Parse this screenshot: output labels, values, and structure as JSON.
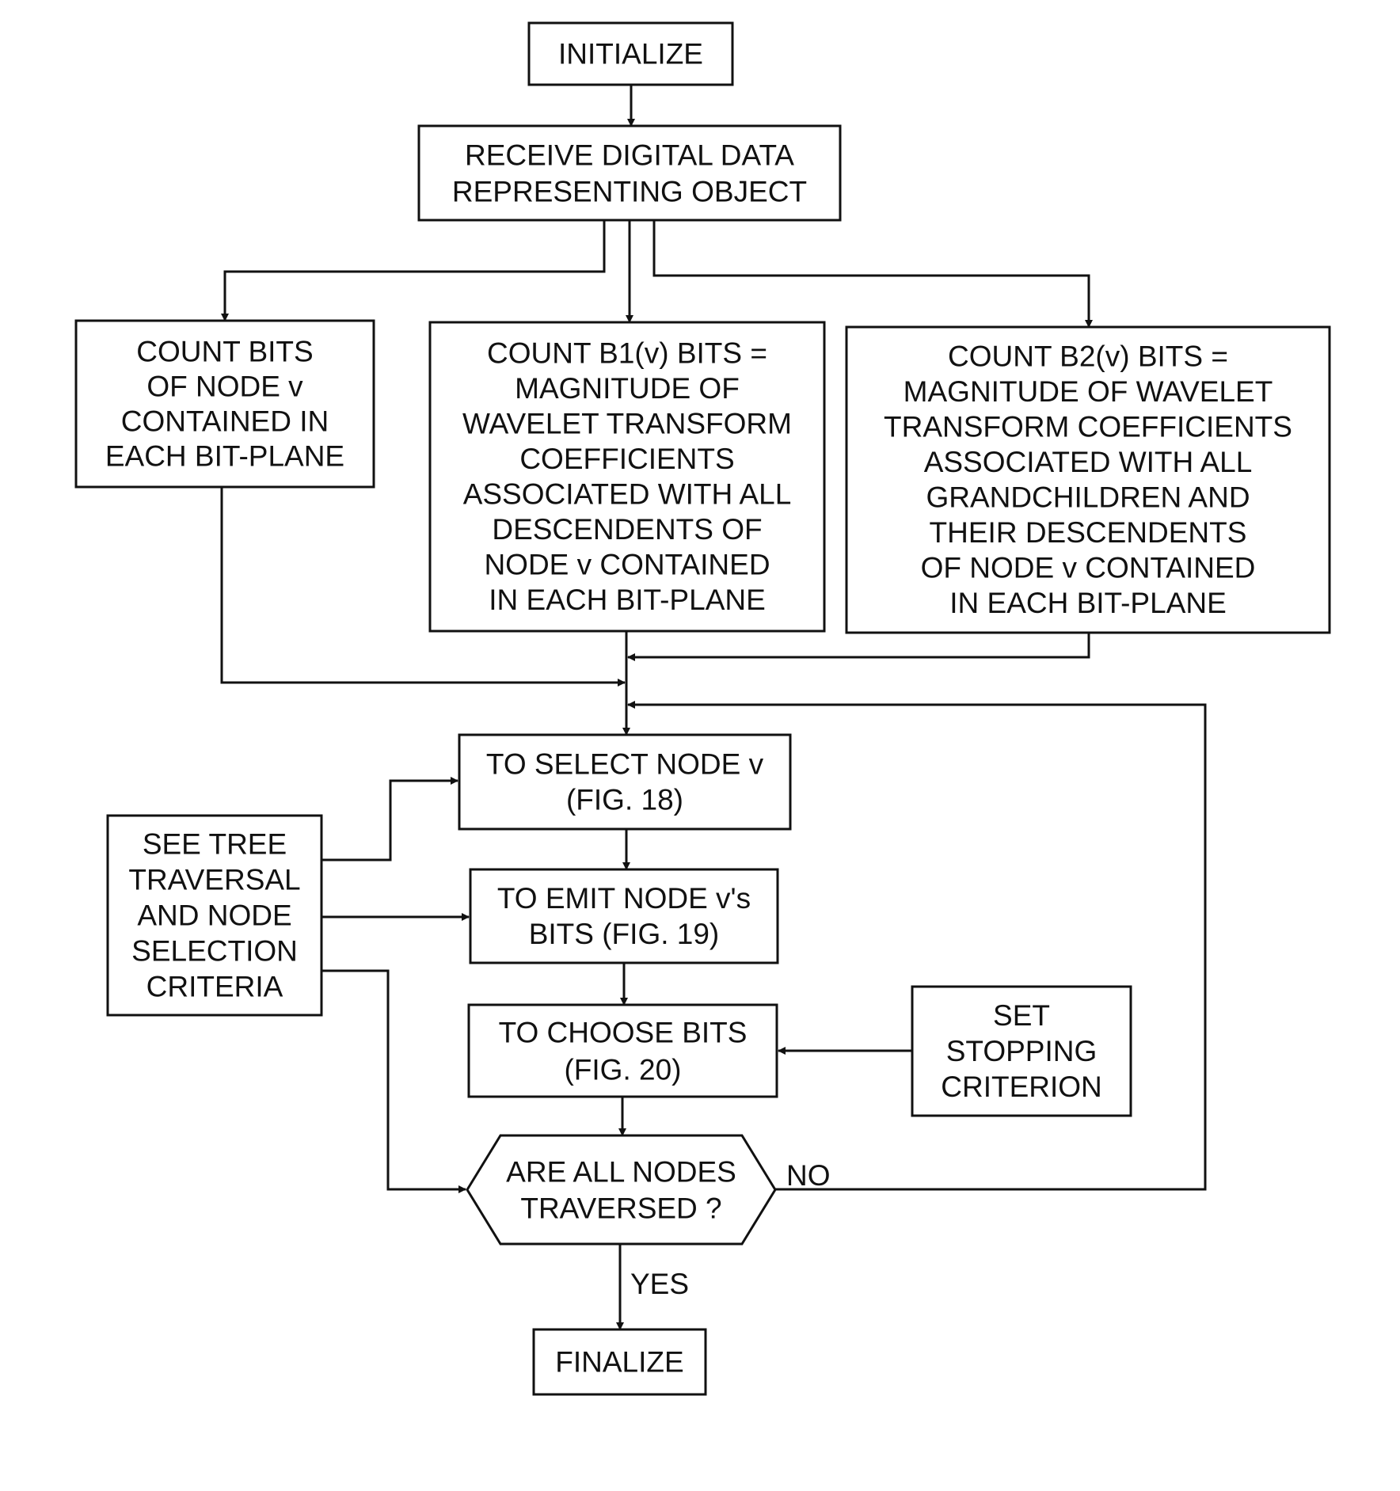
{
  "figure": {
    "type": "flowchart",
    "nodes": [
      {
        "id": "initialize",
        "shape": "rect",
        "lines": [
          "INITIALIZE"
        ]
      },
      {
        "id": "receive",
        "shape": "rect",
        "lines": [
          "RECEIVE DIGITAL DATA",
          "REPRESENTING OBJECT"
        ]
      },
      {
        "id": "count-bits",
        "shape": "rect",
        "lines": [
          "COUNT BITS",
          "OF NODE v",
          "CONTAINED IN",
          "EACH BIT-PLANE"
        ]
      },
      {
        "id": "count-b1",
        "shape": "rect",
        "lines": [
          "COUNT B1(v) BITS =",
          "MAGNITUDE OF",
          "WAVELET TRANSFORM",
          "COEFFICIENTS",
          "ASSOCIATED WITH ALL",
          "DESCENDENTS OF",
          "NODE v CONTAINED",
          "IN EACH BIT-PLANE"
        ]
      },
      {
        "id": "count-b2",
        "shape": "rect",
        "lines": [
          "COUNT B2(v) BITS =",
          "MAGNITUDE OF WAVELET",
          "TRANSFORM COEFFICIENTS",
          "ASSOCIATED WITH ALL",
          "GRANDCHILDREN AND",
          "THEIR DESCENDENTS",
          "OF NODE v CONTAINED",
          "IN EACH BIT-PLANE"
        ]
      },
      {
        "id": "select-node",
        "shape": "rect",
        "lines": [
          "TO SELECT NODE v",
          "(FIG. 18)"
        ]
      },
      {
        "id": "tree-traversal",
        "shape": "rect",
        "lines": [
          "SEE TREE",
          "TRAVERSAL",
          "AND NODE",
          "SELECTION",
          "CRITERIA"
        ]
      },
      {
        "id": "emit-bits",
        "shape": "rect",
        "lines": [
          "TO EMIT NODE v's",
          "BITS (FIG. 19)"
        ]
      },
      {
        "id": "choose-bits",
        "shape": "rect",
        "lines": [
          "TO CHOOSE BITS",
          "(FIG. 20)"
        ]
      },
      {
        "id": "stopping",
        "shape": "rect",
        "lines": [
          "SET",
          "STOPPING",
          "CRITERION"
        ]
      },
      {
        "id": "all-traversed",
        "shape": "hexagon",
        "lines": [
          "ARE ALL NODES",
          "TRAVERSED ?"
        ]
      },
      {
        "id": "finalize",
        "shape": "rect",
        "lines": [
          "FINALIZE"
        ]
      }
    ],
    "edges": [
      {
        "from": "initialize",
        "to": "receive"
      },
      {
        "from": "receive",
        "to": "count-bits"
      },
      {
        "from": "receive",
        "to": "count-b1"
      },
      {
        "from": "receive",
        "to": "count-b2"
      },
      {
        "from": "count-bits",
        "to": "select-node"
      },
      {
        "from": "count-b1",
        "to": "select-node"
      },
      {
        "from": "count-b2",
        "to": "select-node"
      },
      {
        "from": "tree-traversal",
        "to": "select-node"
      },
      {
        "from": "tree-traversal",
        "to": "emit-bits"
      },
      {
        "from": "tree-traversal",
        "to": "all-traversed"
      },
      {
        "from": "select-node",
        "to": "emit-bits"
      },
      {
        "from": "emit-bits",
        "to": "choose-bits"
      },
      {
        "from": "stopping",
        "to": "choose-bits"
      },
      {
        "from": "choose-bits",
        "to": "all-traversed"
      },
      {
        "from": "all-traversed",
        "to": "select-node",
        "label": "NO"
      },
      {
        "from": "all-traversed",
        "to": "finalize",
        "label": "YES"
      }
    ],
    "labels": {
      "no": "NO",
      "yes": "YES"
    }
  }
}
